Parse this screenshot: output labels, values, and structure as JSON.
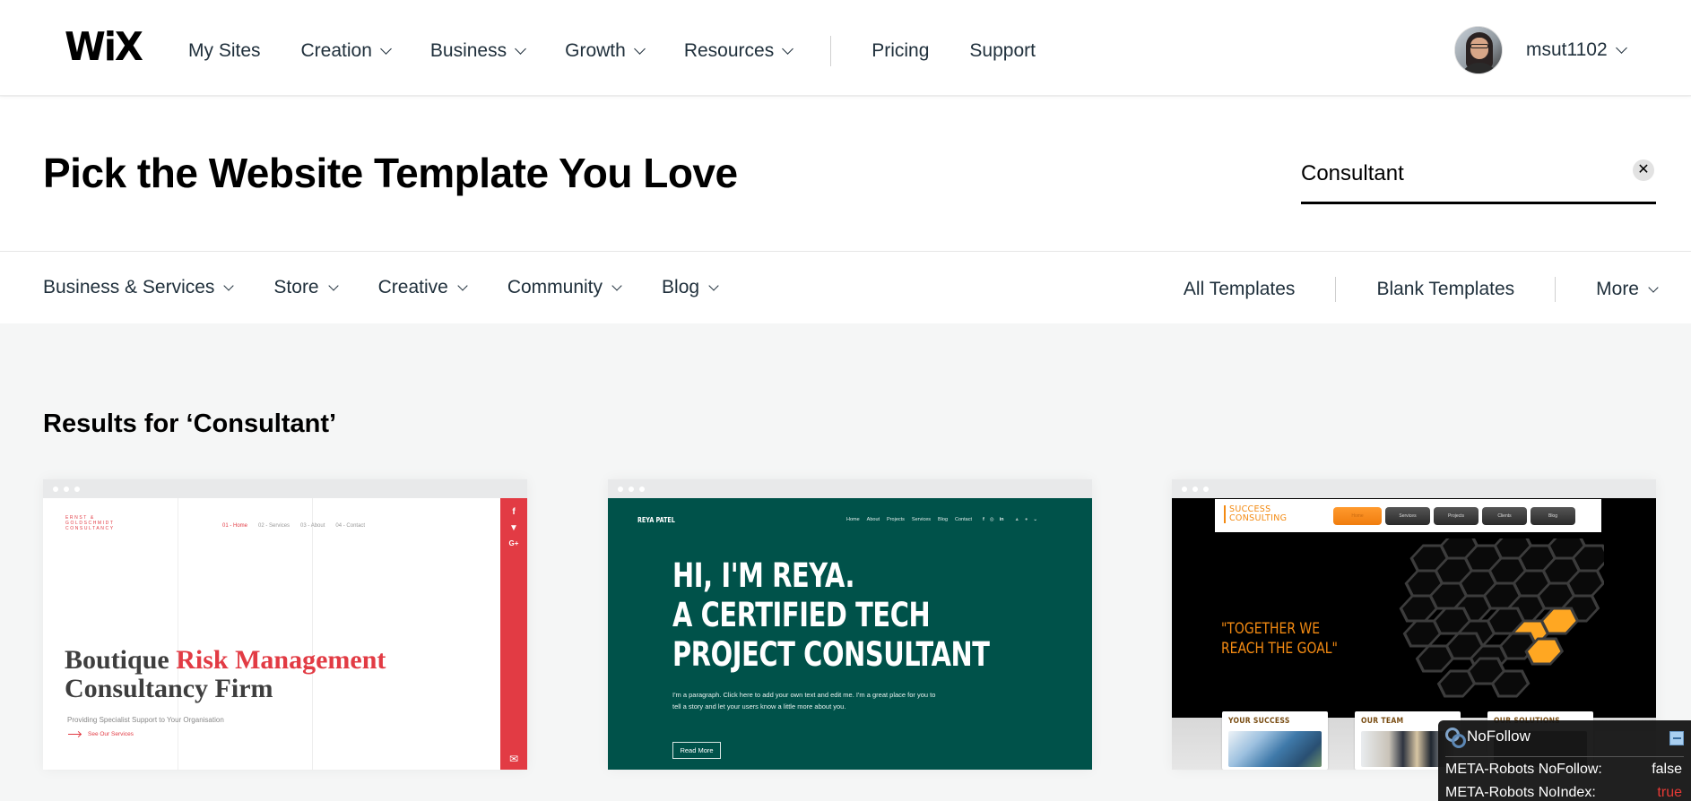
{
  "header": {
    "logo": "WiX",
    "nav": [
      {
        "label": "My Sites",
        "dropdown": false
      },
      {
        "label": "Creation",
        "dropdown": true
      },
      {
        "label": "Business",
        "dropdown": true
      },
      {
        "label": "Growth",
        "dropdown": true
      },
      {
        "label": "Resources",
        "dropdown": true
      }
    ],
    "nav_right": [
      {
        "label": "Pricing"
      },
      {
        "label": "Support"
      }
    ],
    "user": {
      "name": "msut1102",
      "avatar_icon": "user-avatar"
    }
  },
  "hero": {
    "title": "Pick the Website Template You Love",
    "search": {
      "value": "Consultant",
      "clear_icon": "close-icon",
      "clear_glyph": "✕"
    }
  },
  "categories": {
    "left": [
      {
        "label": "Business & Services"
      },
      {
        "label": "Store"
      },
      {
        "label": "Creative"
      },
      {
        "label": "Community"
      },
      {
        "label": "Blog"
      }
    ],
    "right": [
      {
        "label": "All Templates"
      },
      {
        "label": "Blank Templates"
      },
      {
        "label": "More"
      }
    ]
  },
  "results": {
    "title": "Results for ‘Consultant’",
    "templates": [
      {
        "name": "Risk Management Consultancy",
        "brand": "ERNST & GOLDSCHMIDT CONSULTANCY",
        "menu": [
          "01 - Home",
          "02 - Services",
          "03 - About",
          "04 - Contact"
        ],
        "headline_part1": "Boutique ",
        "headline_accent": "Risk Management",
        "headline_part2": "Consultancy Firm",
        "subtitle": "Providing Specialist Support to Your Organisation",
        "cta": "See Our Services",
        "social": [
          "f",
          "t",
          "G+"
        ],
        "accent_color": "#e23b44"
      },
      {
        "name": "Tech Project Consultant",
        "brand": "REYA PATEL",
        "menu": [
          "Home",
          "About",
          "Projects",
          "Services",
          "Blog",
          "Contact"
        ],
        "social": [
          "f",
          "◎",
          "in"
        ],
        "headline_lines": [
          "HI, I'M REYA.",
          "A CERTIFIED TECH",
          "PROJECT CONSULTANT"
        ],
        "paragraph": "I'm a paragraph. Click here to add your own text and edit me. I'm a great place for you to tell a story and let your users know a little more about you.",
        "button": "Read More",
        "bg_color": "#00524a"
      },
      {
        "name": "Success Consulting",
        "brand_line1": "SUCCESS",
        "brand_line2": "CONSULTING",
        "menu": [
          "Home",
          "Services",
          "Projects",
          "Clients",
          "Blog"
        ],
        "quote_line1": "\"TOGETHER WE",
        "quote_line2": " REACH THE GOAL\"",
        "boxes": [
          "YOUR SUCCESS",
          "OUR TEAM",
          "OUR SOLUTIONS"
        ],
        "accent_color": "#f38a12"
      }
    ]
  },
  "nofollow_panel": {
    "title": "NoFollow",
    "rows": [
      {
        "label": "META-Robots NoFollow:",
        "value": "false"
      },
      {
        "label": "META-Robots NoIndex:",
        "value": "true"
      }
    ]
  }
}
